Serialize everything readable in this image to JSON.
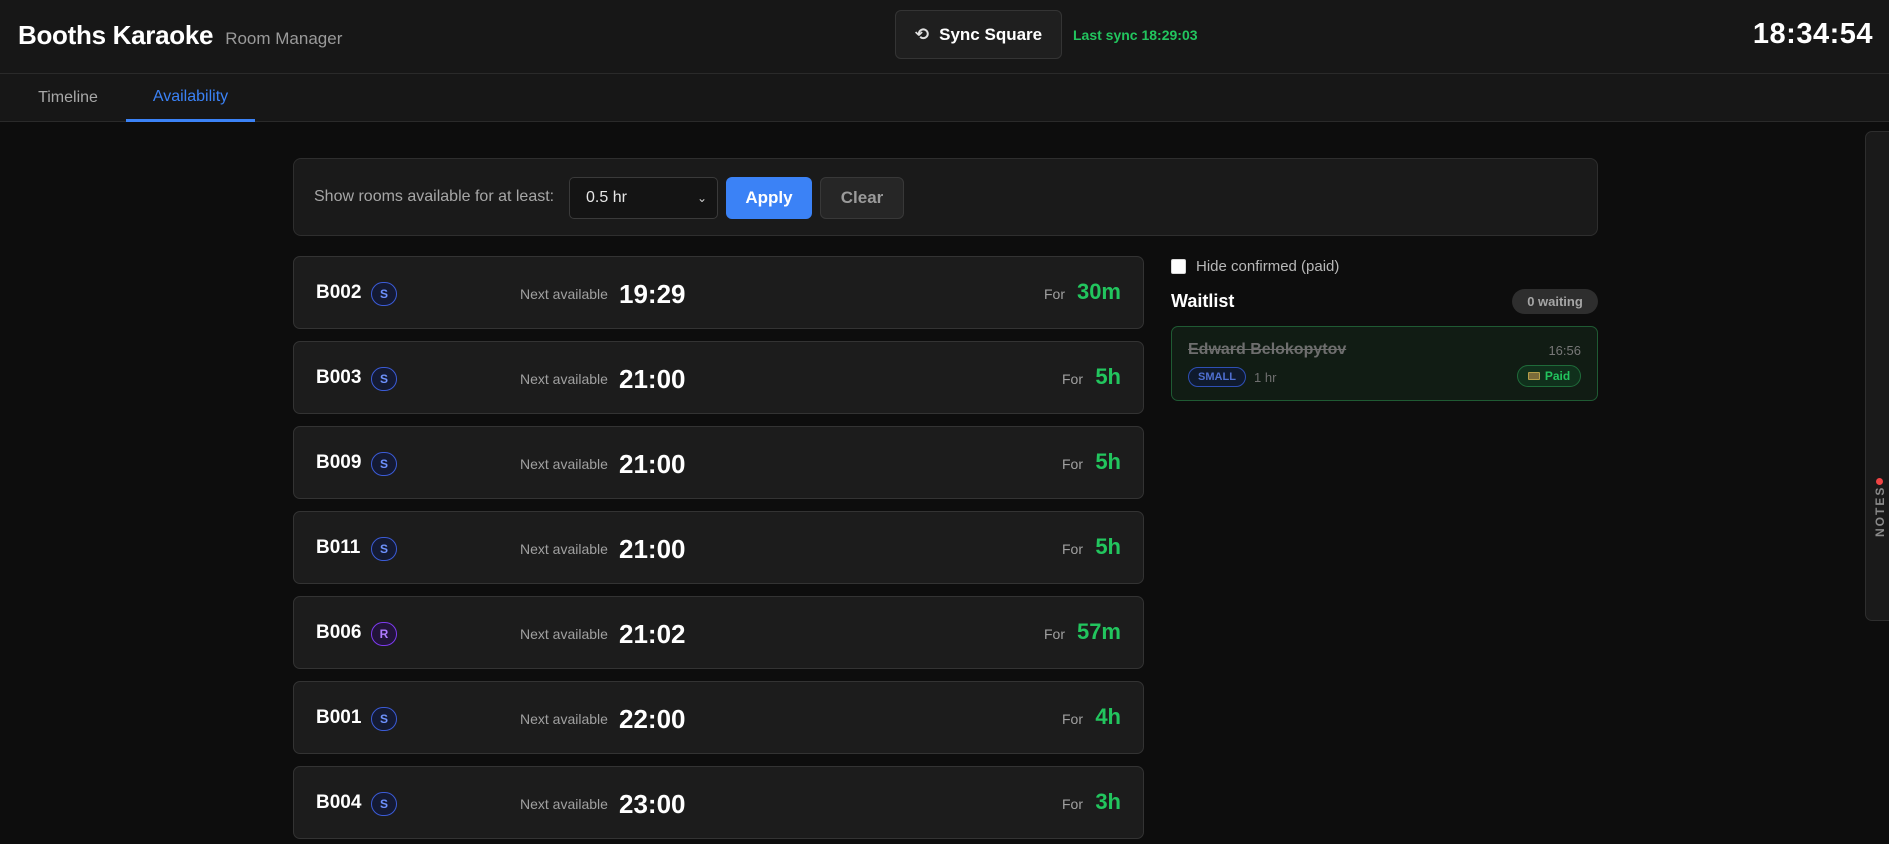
{
  "header": {
    "title": "Booths Karaoke",
    "subtitle": "Room Manager",
    "sync_label": "Sync Square",
    "sync_icon": "sync-icon",
    "last_sync": "Last sync 18:29:03",
    "clock": "18:34:54"
  },
  "tabs": [
    {
      "label": "Timeline",
      "active": false
    },
    {
      "label": "Availability",
      "active": true
    }
  ],
  "filter": {
    "label": "Show rooms available for at least:",
    "selected": "0.5 hr",
    "apply_label": "Apply",
    "clear_label": "Clear"
  },
  "rooms": [
    {
      "id": "B002",
      "badge": "S",
      "next_label": "Next available",
      "next_time": "19:29",
      "for_label": "For",
      "duration": "30m"
    },
    {
      "id": "B003",
      "badge": "S",
      "next_label": "Next available",
      "next_time": "21:00",
      "for_label": "For",
      "duration": "5h"
    },
    {
      "id": "B009",
      "badge": "S",
      "next_label": "Next available",
      "next_time": "21:00",
      "for_label": "For",
      "duration": "5h"
    },
    {
      "id": "B011",
      "badge": "S",
      "next_label": "Next available",
      "next_time": "21:00",
      "for_label": "For",
      "duration": "5h"
    },
    {
      "id": "B006",
      "badge": "R",
      "next_label": "Next available",
      "next_time": "21:02",
      "for_label": "For",
      "duration": "57m"
    },
    {
      "id": "B001",
      "badge": "S",
      "next_label": "Next available",
      "next_time": "22:00",
      "for_label": "For",
      "duration": "4h"
    },
    {
      "id": "B004",
      "badge": "S",
      "next_label": "Next available",
      "next_time": "23:00",
      "for_label": "For",
      "duration": "3h"
    }
  ],
  "waitlist": {
    "hide_confirmed_label": "Hide confirmed (paid)",
    "hide_confirmed_checked": false,
    "title": "Waitlist",
    "count_label": "0 waiting",
    "entries": [
      {
        "name": "Edward Belokopytov",
        "time": "16:56",
        "size": "SMALL",
        "duration": "1 hr",
        "status": "Paid"
      }
    ]
  },
  "notes": {
    "label": "NOTES"
  },
  "colors": {
    "accent": "#3b82f6",
    "success": "#22c55e",
    "badge_s": "#3b5bd6",
    "badge_r": "#7c3aed",
    "notes_dot": "#ef4444"
  }
}
